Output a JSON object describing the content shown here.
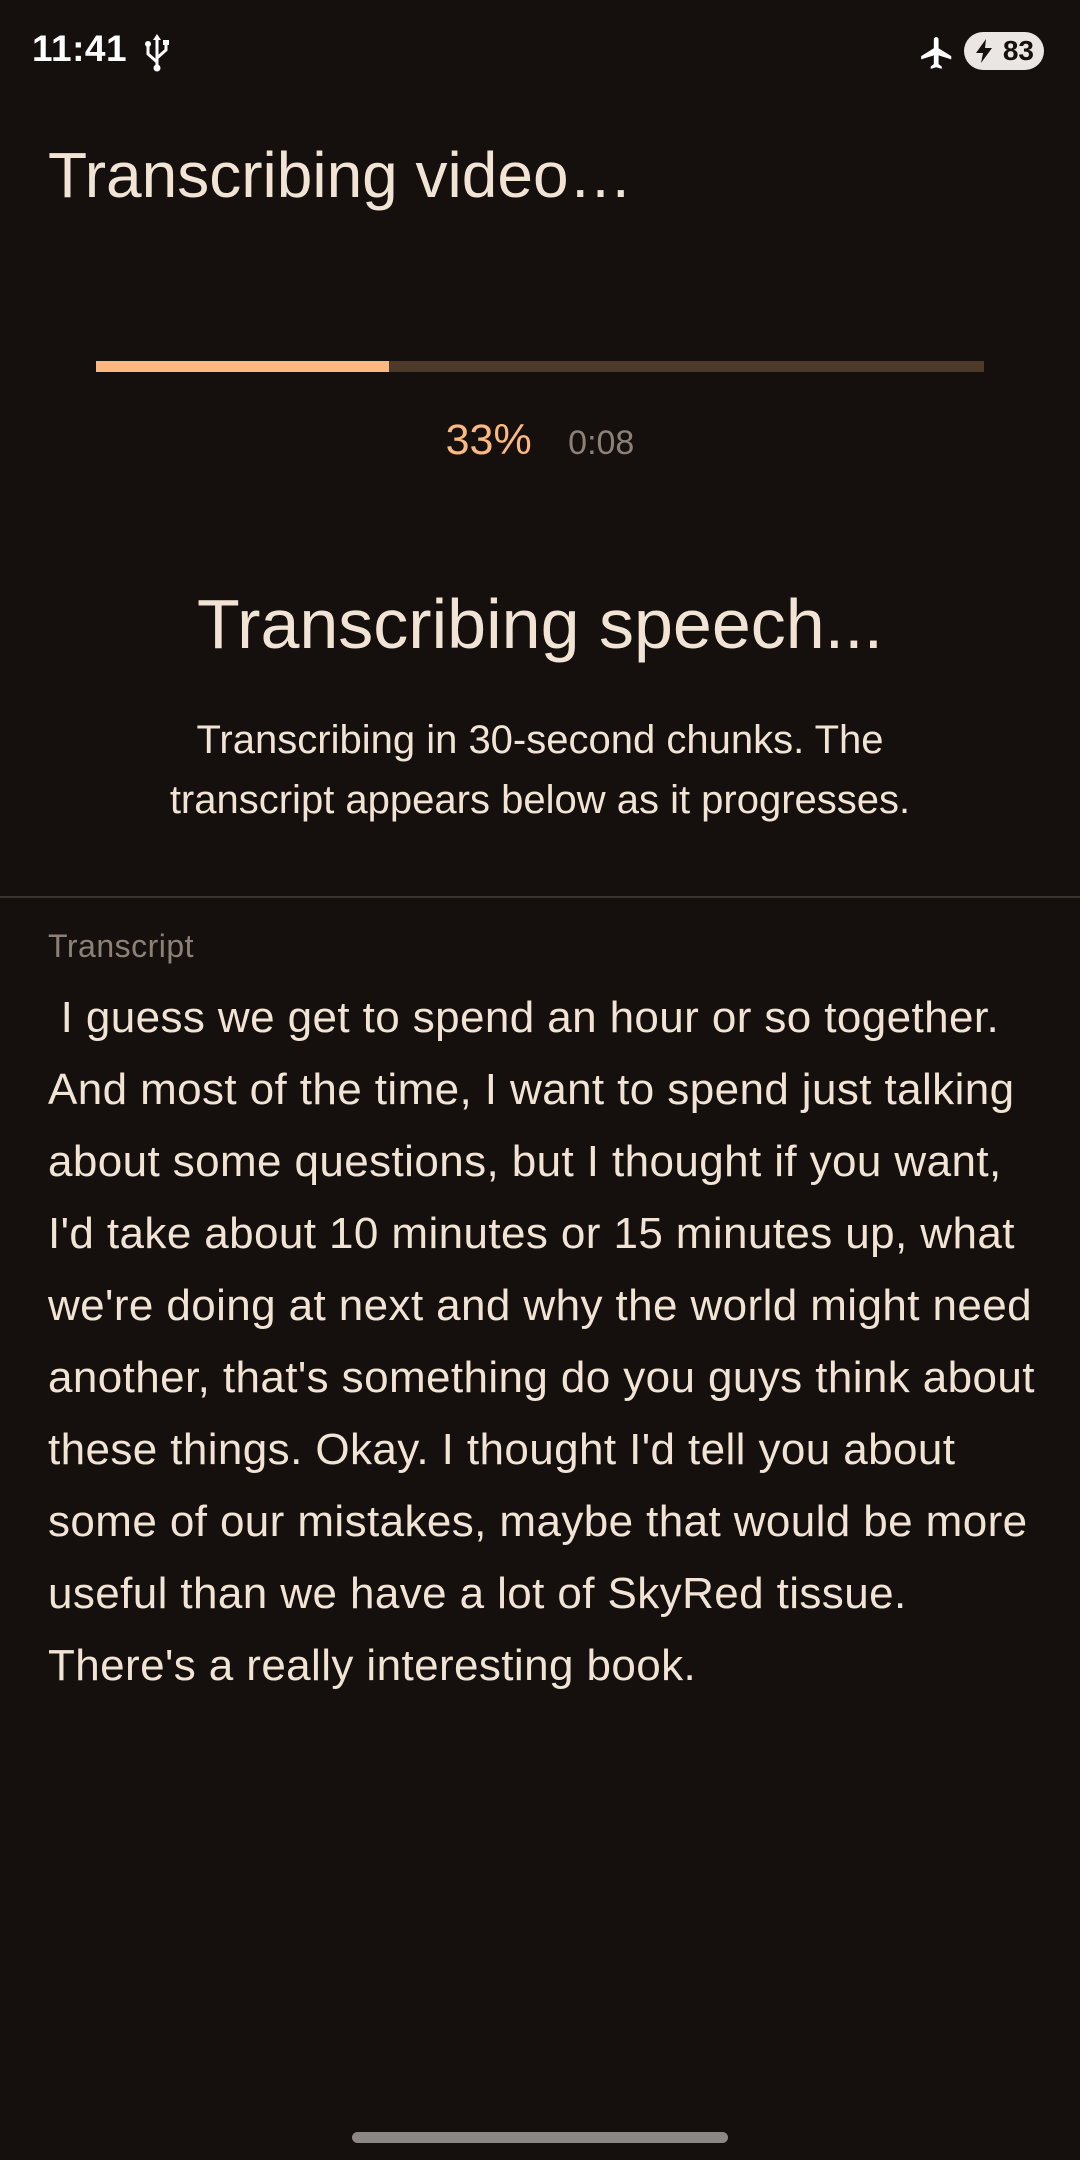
{
  "status_bar": {
    "time": "11:41",
    "battery_level": "83",
    "icons": [
      "usb-icon",
      "airplane-mode-icon",
      "battery-charging-icon"
    ]
  },
  "header": {
    "title": "Transcribing video…"
  },
  "progress": {
    "percent_label": "33%",
    "fraction": 0.33,
    "elapsed": "0:08"
  },
  "stage": {
    "title": "Transcribing speech...",
    "description": "Transcribing in 30-second chunks. The transcript appears below as it progresses."
  },
  "transcript": {
    "label": "Transcript",
    "text": " I guess we get to spend an hour or so together. And most of the time, I want to spend just talking about some questions, but I thought if you want, I'd take about 10 minutes or 15 minutes up, what we're doing at next and why the world might need another, that's something do you guys think about these things. Okay. I thought I'd tell you about some of our mistakes, maybe that would be more useful than we have a lot of SkyRed tissue. There's a really interesting book."
  },
  "colors": {
    "background": "#15100d",
    "accent": "#fbb880",
    "track": "#4d3a2a",
    "text": "#f1e4d4",
    "muted": "#8c8178"
  }
}
